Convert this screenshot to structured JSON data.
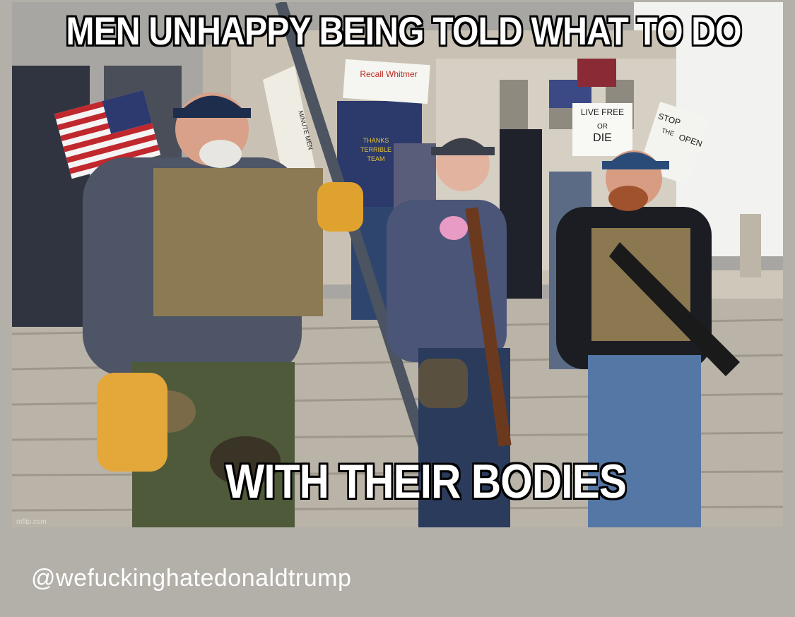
{
  "meme": {
    "top_text": "MEN UNHAPPY BEING TOLD WHAT TO DO",
    "bottom_text": "WITH THEIR BODIES",
    "watermark": "mflip.com"
  },
  "signs": {
    "recall": "Recall Whitmer",
    "live_free_1": "LIVE FREE",
    "live_free_2": "OR",
    "live_free_3": "DIE",
    "stop_1": "STOP",
    "stop_2": "THE",
    "stop_3": "OPEN",
    "banner": "MINUTE MEN",
    "shirt": "THANKS TERRIBLE TEAM"
  },
  "post": {
    "handle": "@wefuckinghatedonaldtrump"
  },
  "colors": {
    "background": "#b3afa9",
    "caption_text": "#ffffff",
    "handle_text": "#ffffff"
  }
}
